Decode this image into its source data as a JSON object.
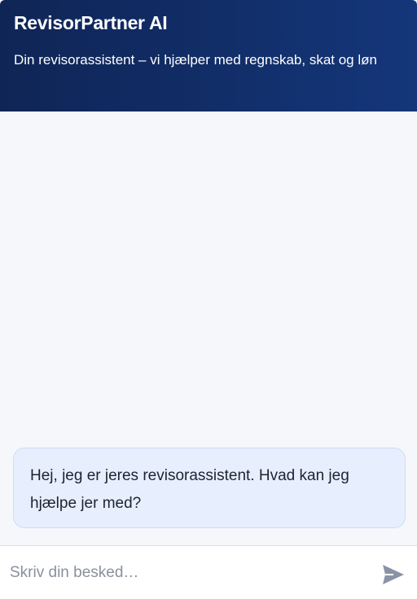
{
  "header": {
    "title": "RevisorPartner AI",
    "subtitle": "Din revisorassistent – vi hjælper med regnskab, skat og løn"
  },
  "messages": [
    {
      "role": "assistant",
      "text": "Hej, jeg er jeres revisorassistent. Hvad kan jeg hjælpe jer med?"
    }
  ],
  "composer": {
    "placeholder": "Skriv din besked…",
    "value": "",
    "send_icon": "send-icon"
  },
  "colors": {
    "header_start": "#0f2555",
    "header_end": "#14367a",
    "bubble_bg": "#e7effe",
    "chat_bg": "#f5f7fb",
    "send_icon": "#8a93a6"
  }
}
